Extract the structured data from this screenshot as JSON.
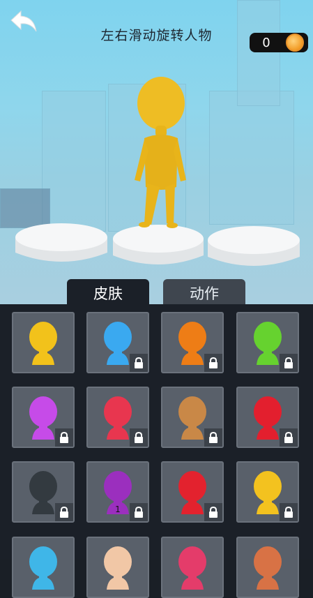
{
  "header": {
    "title": "左右滑动旋转人物"
  },
  "coins": {
    "value": "0"
  },
  "tabs": [
    {
      "label": "皮肤"
    },
    {
      "label": "动作"
    }
  ],
  "character": {
    "color": "#e8b41a"
  },
  "skins": [
    {
      "color": "#f2c21b",
      "locked": false,
      "icon": "yellow-head-icon"
    },
    {
      "color": "#3aa9f0",
      "locked": true,
      "icon": "blue-head-icon"
    },
    {
      "color": "#ee7d16",
      "locked": true,
      "icon": "orange-head-icon"
    },
    {
      "color": "#66d22f",
      "locked": true,
      "icon": "green-head-icon"
    },
    {
      "color": "#c64be8",
      "locked": true,
      "icon": "purple-head-icon"
    },
    {
      "color": "#e8364f",
      "locked": true,
      "icon": "red-head-icon"
    },
    {
      "color": "#c98847",
      "locked": true,
      "icon": "tan-head-icon"
    },
    {
      "color": "#e31f2e",
      "locked": true,
      "icon": "masked-hero-head-icon"
    },
    {
      "color": "#333a40",
      "locked": true,
      "icon": "ninja-head-icon"
    },
    {
      "color": "#9b2fbe",
      "locked": true,
      "icon": "purple-number-one-head-icon",
      "badge": "1"
    },
    {
      "color": "#e3222e",
      "locked": true,
      "icon": "spider-hero-head-icon"
    },
    {
      "color": "#f3c21f",
      "locked": true,
      "icon": "yellow-overalls-head-icon"
    },
    {
      "color": "#3fb6e8",
      "locked": false,
      "icon": "cyan-head-icon"
    },
    {
      "color": "#f1c7a6",
      "locked": false,
      "icon": "skin-tone-head-icon"
    },
    {
      "color": "#e43c6a",
      "locked": false,
      "icon": "pink-head-icon"
    },
    {
      "color": "#d87245",
      "locked": false,
      "icon": "copper-head-icon"
    }
  ]
}
